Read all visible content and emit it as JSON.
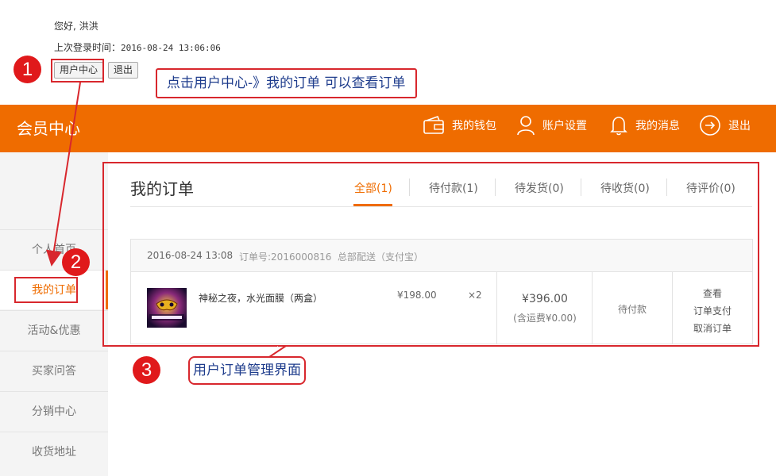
{
  "greeting": "您好, 洪洪",
  "last_login": {
    "label": "上次登录时间：",
    "time": "2016-08-24 13:06:06"
  },
  "top_buttons": {
    "user_center": "用户中心",
    "logout": "退出"
  },
  "annotations": {
    "steps": [
      "1",
      "2",
      "3"
    ],
    "note1": "点击用户中心-》我的订单 可以查看订单",
    "note3": "用户订单管理界面",
    "color": "#d8272d"
  },
  "header": {
    "brand": "会员中心",
    "nav": [
      {
        "label": "我的钱包",
        "icon": "wallet-icon"
      },
      {
        "label": "账户设置",
        "icon": "user-icon"
      },
      {
        "label": "我的消息",
        "icon": "bell-icon"
      },
      {
        "label": "退出",
        "icon": "exit-icon"
      }
    ],
    "bg_color": "#ef6c00"
  },
  "sidebar": {
    "items": [
      {
        "label": "个人首页"
      },
      {
        "label": "我的订单",
        "active": true
      },
      {
        "label": "活动&优惠"
      },
      {
        "label": "买家问答"
      },
      {
        "label": "分销中心"
      },
      {
        "label": "收货地址"
      }
    ]
  },
  "orders": {
    "title": "我的订单",
    "tabs": [
      {
        "label": "全部",
        "count": "(1)",
        "active": true
      },
      {
        "label": "待付款",
        "count": "(1)"
      },
      {
        "label": "待发货",
        "count": "(0)"
      },
      {
        "label": "待收货",
        "count": "(0)"
      },
      {
        "label": "待评价",
        "count": "(0)"
      }
    ],
    "list": [
      {
        "date": "2016-08-24 13:08",
        "order_no": "订单号:2016000816",
        "shipping": "总部配送（支付宝）",
        "product_name": "神秘之夜，水光面膜（两盒）",
        "price": "¥198.00",
        "qty": "×2",
        "total": "¥396.00",
        "freight": "(含运费¥0.00)",
        "status": "待付款",
        "actions": [
          "查看",
          "订单支付",
          "取消订单"
        ]
      }
    ]
  }
}
